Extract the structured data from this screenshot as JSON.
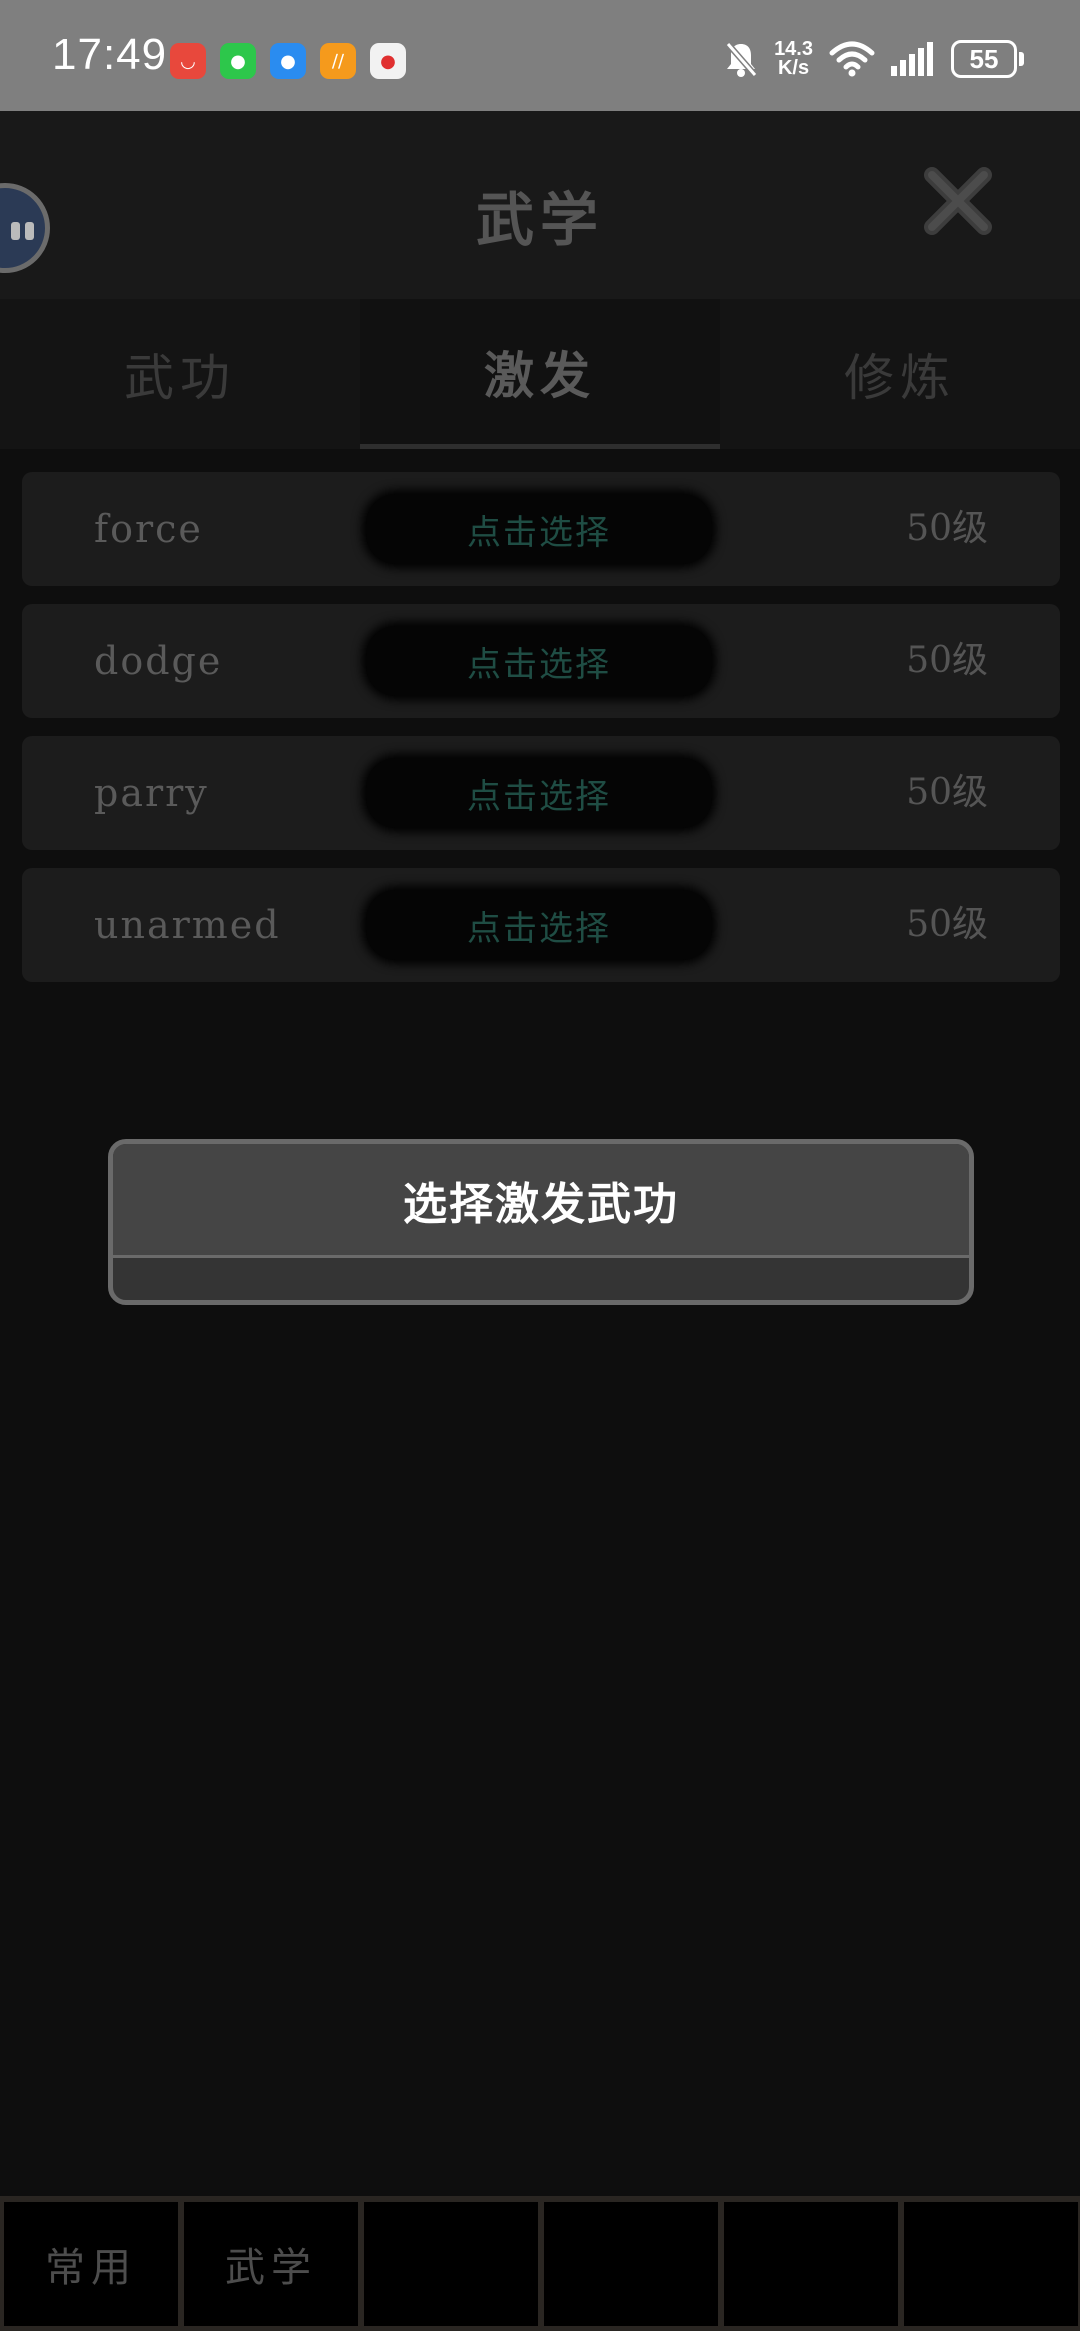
{
  "status_bar": {
    "time": "17:49",
    "speed_value": "14.3",
    "speed_unit": "K/s",
    "battery": "55",
    "app_icons": [
      "weibo-icon",
      "wechat-icon",
      "message-icon",
      "orange-app-icon",
      "map-icon"
    ]
  },
  "header": {
    "title": "武学"
  },
  "tabs": [
    {
      "label": "武功",
      "active": false
    },
    {
      "label": "激发",
      "active": true
    },
    {
      "label": "修炼",
      "active": false
    }
  ],
  "skills": [
    {
      "name": "force",
      "select_label": "点击选择",
      "level": "50级"
    },
    {
      "name": "dodge",
      "select_label": "点击选择",
      "level": "50级"
    },
    {
      "name": "parry",
      "select_label": "点击选择",
      "level": "50级"
    },
    {
      "name": "unarmed",
      "select_label": "点击选择",
      "level": "50级"
    }
  ],
  "dialog": {
    "title": "选择激发武功"
  },
  "bottom_nav": [
    {
      "label": "常用"
    },
    {
      "label": "武学"
    },
    {
      "label": ""
    },
    {
      "label": ""
    },
    {
      "label": ""
    },
    {
      "label": ""
    }
  ],
  "colors": {
    "background": "#0e0e0e",
    "status_bar": "#7f7f7f",
    "select_text": "#1f4d44",
    "dialog_title": "#454545"
  }
}
